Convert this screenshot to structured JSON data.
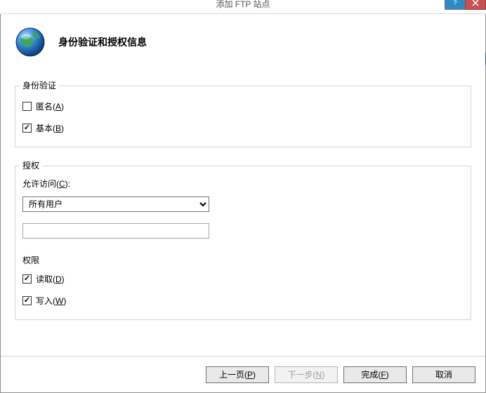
{
  "window": {
    "title": "添加 FTP 站点"
  },
  "header": {
    "heading": "身份验证和授权信息"
  },
  "auth_group": {
    "legend": "身份验证",
    "anonymous": {
      "label_pre": "匿名(",
      "hotkey": "A",
      "label_post": ")",
      "checked": false
    },
    "basic": {
      "label_pre": "基本(",
      "hotkey": "B",
      "label_post": ")",
      "checked": true
    }
  },
  "authz_group": {
    "legend": "授权",
    "allow_access": {
      "label_pre": "允许访问(",
      "hotkey": "C",
      "label_post": "):"
    },
    "access_selected": "所有用户",
    "access_options": [
      "所有用户"
    ],
    "input_value": "",
    "perms_label": "权限",
    "read": {
      "label_pre": "读取(",
      "hotkey": "D",
      "label_post": ")",
      "checked": true
    },
    "write": {
      "label_pre": "写入(",
      "hotkey": "W",
      "label_post": ")",
      "checked": true
    }
  },
  "footer": {
    "prev": {
      "pre": "上一页(",
      "hotkey": "P",
      "post": ")"
    },
    "next": {
      "pre": "下一步(",
      "hotkey": "N",
      "post": ")"
    },
    "finish": {
      "pre": "完成(",
      "hotkey": "F",
      "post": ")"
    },
    "cancel": {
      "text": "取消"
    }
  }
}
